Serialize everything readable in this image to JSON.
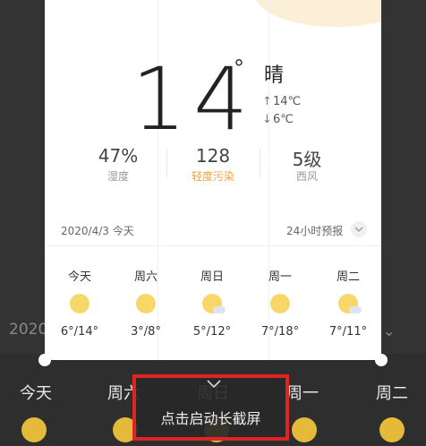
{
  "weather": {
    "temp": "14",
    "degree_sign": "°",
    "condition": "晴",
    "high": "14℃",
    "low": "6℃",
    "stats": [
      {
        "value": "47%",
        "label": "湿度"
      },
      {
        "value": "128",
        "label": "轻度污染"
      },
      {
        "value": "5级",
        "label": "西风"
      }
    ],
    "date": "2020/4/3 今天",
    "forecast_link": "24小时预报",
    "forecast": [
      {
        "day": "今天",
        "temp": "6°/14°",
        "icon": "sun-icon"
      },
      {
        "day": "周六",
        "temp": "3°/8°",
        "icon": "sun-icon"
      },
      {
        "day": "周日",
        "temp": "5°/12°",
        "icon": "sun-cloud-icon"
      },
      {
        "day": "周一",
        "temp": "7°/18°",
        "icon": "sun-icon"
      },
      {
        "day": "周二",
        "temp": "7°/11°",
        "icon": "sun-cloud-icon"
      }
    ]
  },
  "background": {
    "date_fragment": "2020",
    "days": [
      "今天",
      "周六",
      "周日",
      "周一",
      "周二"
    ]
  },
  "screenshot_overlay": {
    "label": "点击启动长截屏"
  }
}
